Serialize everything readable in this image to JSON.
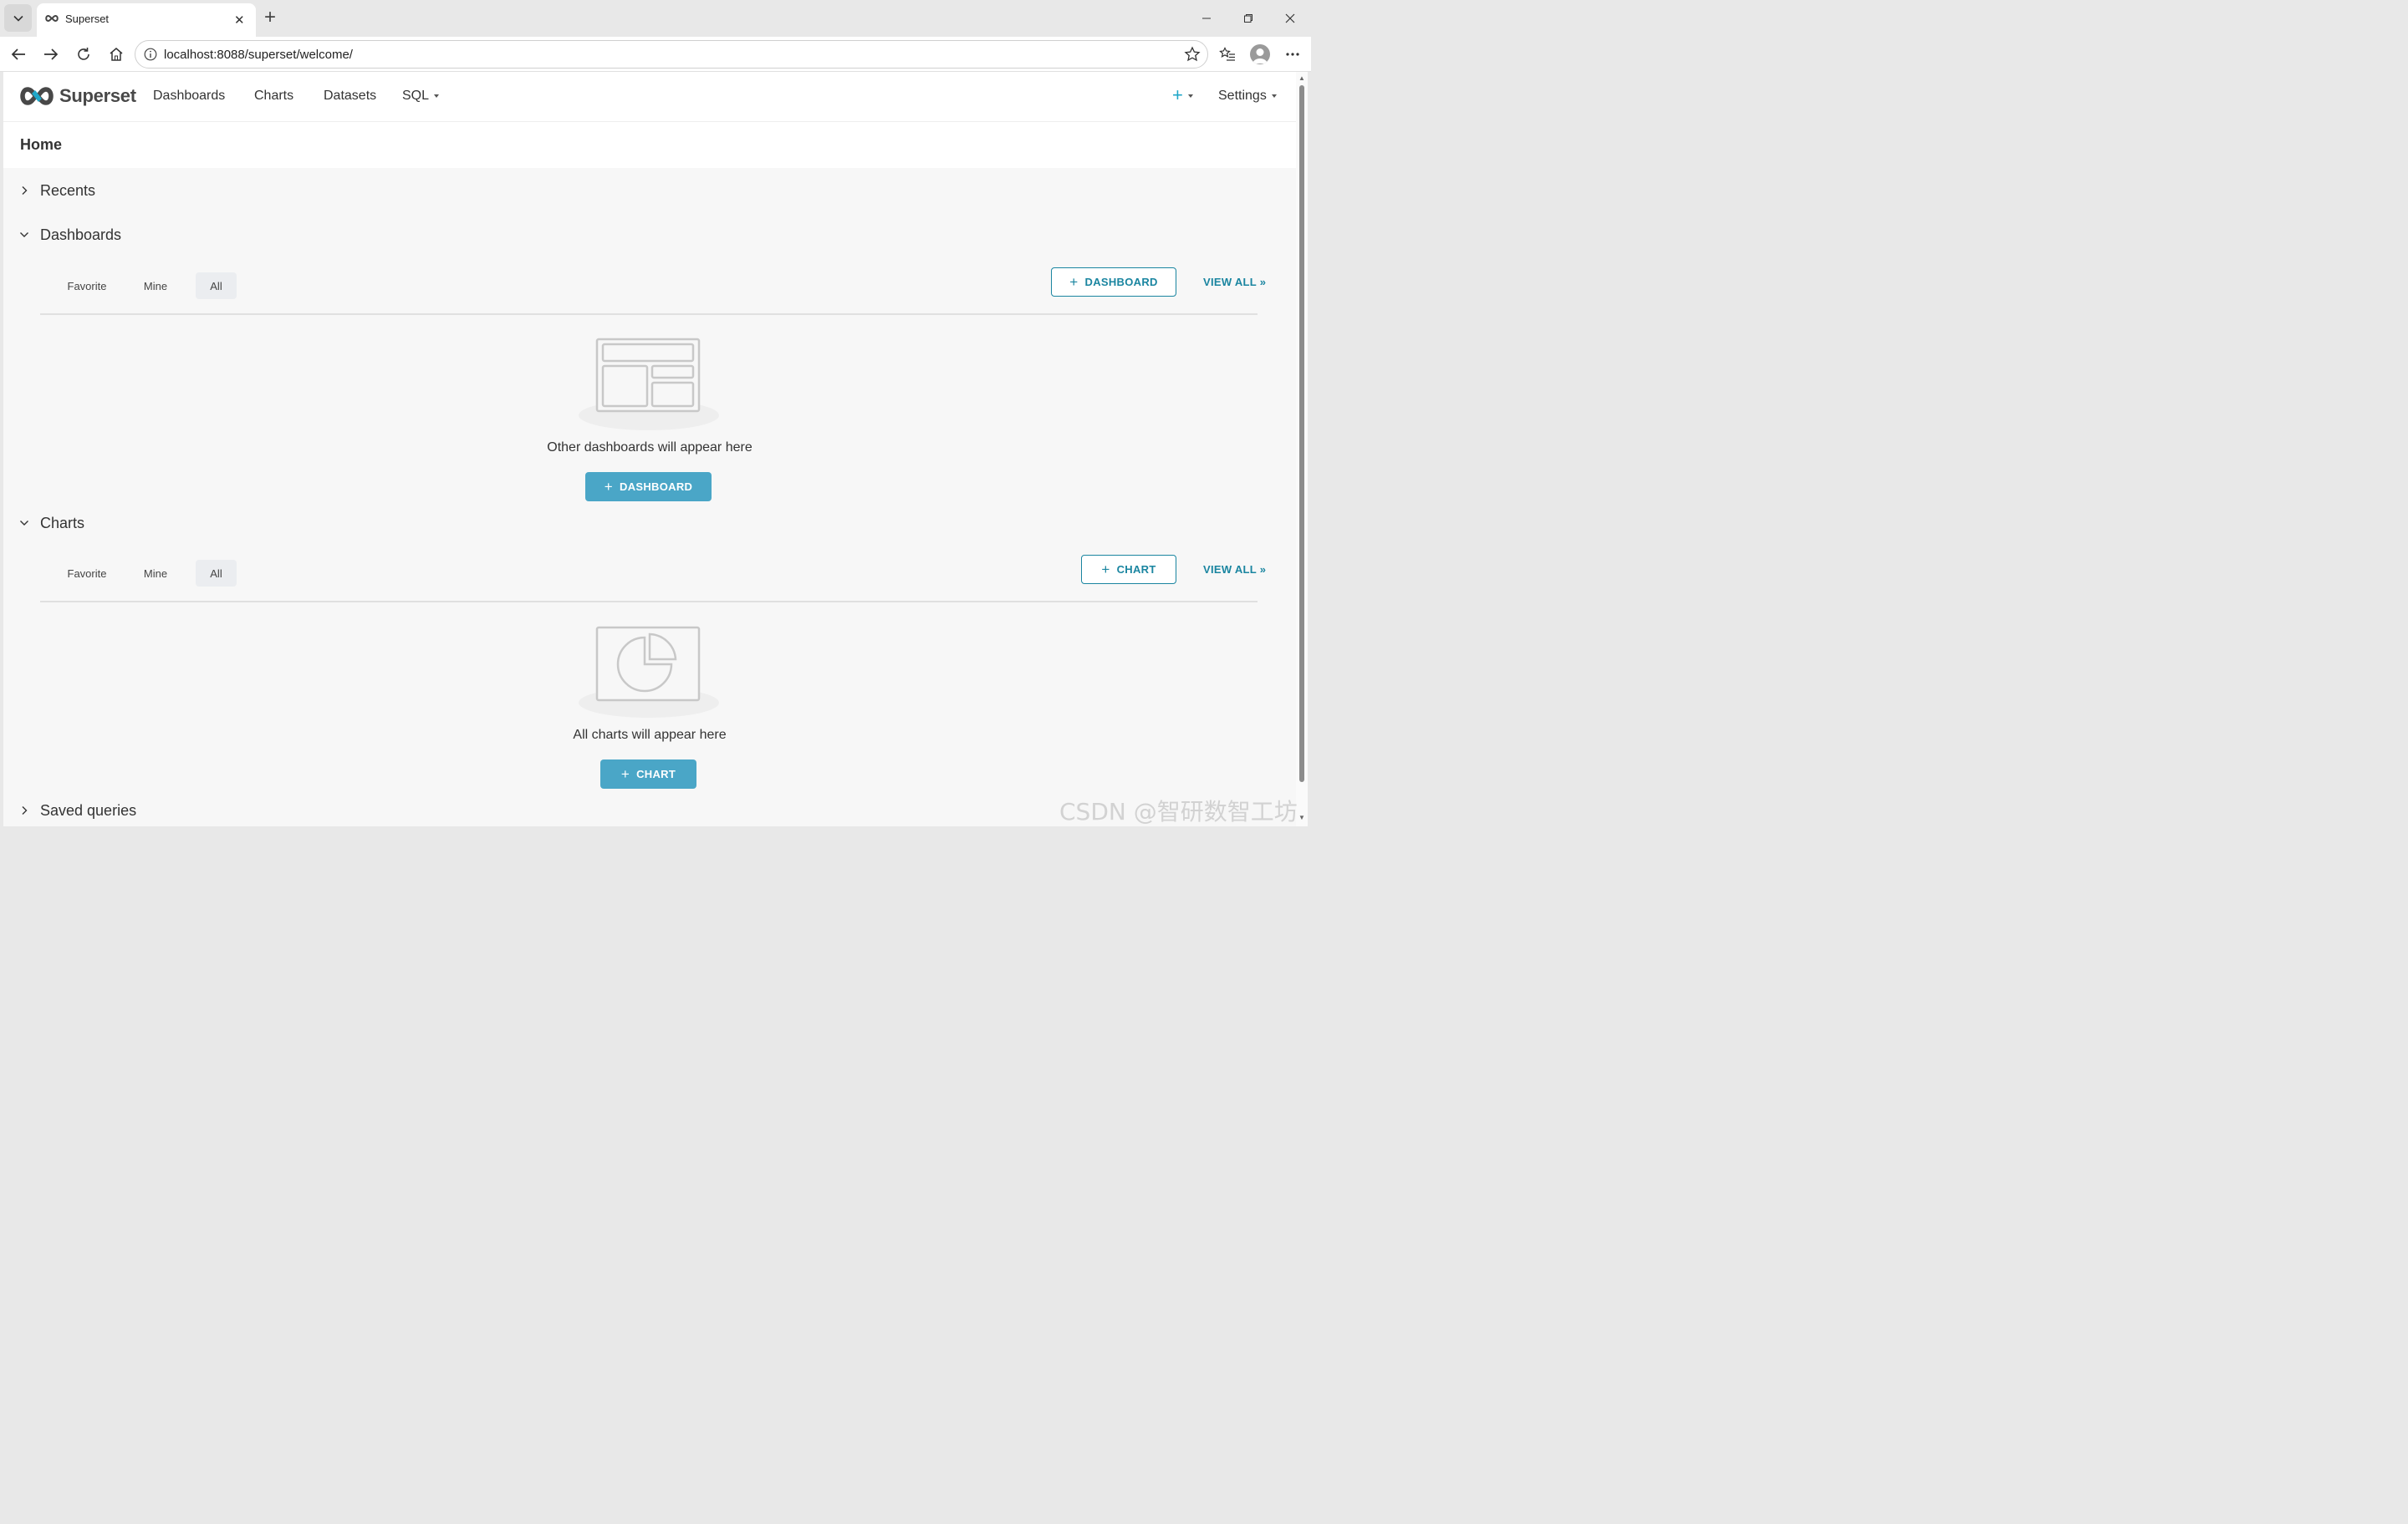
{
  "browser": {
    "tab_title": "Superset",
    "url": "localhost:8088/superset/welcome/"
  },
  "navbar": {
    "brand": "Superset",
    "items": [
      {
        "label": "Dashboards"
      },
      {
        "label": "Charts"
      },
      {
        "label": "Datasets"
      },
      {
        "label": "SQL"
      }
    ],
    "plus_label": "+",
    "settings_label": "Settings"
  },
  "page": {
    "title": "Home"
  },
  "sections": {
    "recents": {
      "label": "Recents"
    },
    "dashboards": {
      "label": "Dashboards",
      "filters": [
        "Favorite",
        "Mine",
        "All"
      ],
      "active_filter": "All",
      "add_button": "DASHBOARD",
      "view_all": "VIEW ALL »",
      "empty_text": "Other dashboards will appear here",
      "empty_button": "DASHBOARD"
    },
    "charts": {
      "label": "Charts",
      "filters": [
        "Favorite",
        "Mine",
        "All"
      ],
      "active_filter": "All",
      "add_button": "CHART",
      "view_all": "VIEW ALL »",
      "empty_text": "All charts will appear here",
      "empty_button": "CHART"
    },
    "saved_queries": {
      "label": "Saved queries"
    }
  },
  "watermark": "CSDN @智研数智工坊",
  "colors": {
    "accent": "#1a85a0",
    "primary_button": "#4aa6c7",
    "plus_icon": "#20a7c9"
  }
}
